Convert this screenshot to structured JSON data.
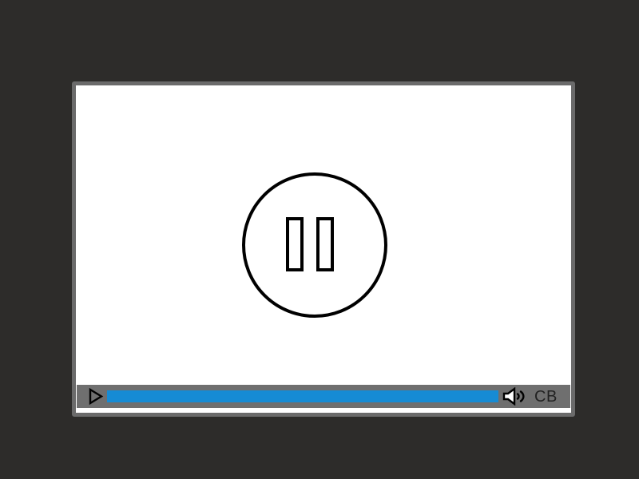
{
  "player": {
    "center_control": {
      "icon": "pause-icon"
    },
    "controls": {
      "play_icon": "play-icon",
      "volume_icon": "volume-icon",
      "cb_label": "CB",
      "progress_fraction": 1.0
    },
    "colors": {
      "background": "#2d2c2a",
      "frame": "#6b6b6b",
      "video": "#ffffff",
      "control_bar": "#6f6f6f",
      "progress": "#168bd4",
      "icon": "#000000"
    }
  }
}
